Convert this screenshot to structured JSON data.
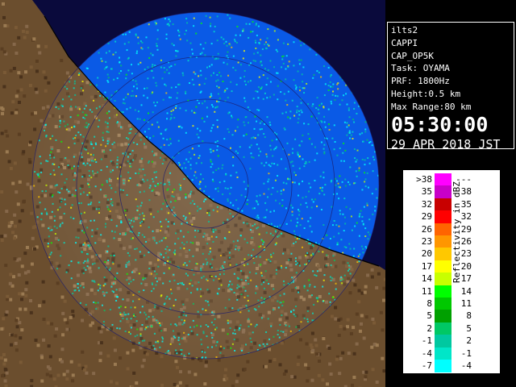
{
  "info": {
    "lines": [
      "ilts2",
      "CAPPI",
      "CAP_OP5K",
      "Task: OYAMA",
      "PRF: 1800Hz",
      "Height:0.5 km",
      "Max Range:80 km"
    ],
    "time": "05:30:00",
    "date": "29 APR 2018 JST"
  },
  "legend": {
    "unit_label": "Reflectivity in dBZ",
    "rows": [
      {
        "lo": ">38",
        "hi": "---",
        "color": "#ff00ff"
      },
      {
        "lo": "35",
        "hi": "38",
        "color": "#c800c8"
      },
      {
        "lo": "32",
        "hi": "35",
        "color": "#c80000"
      },
      {
        "lo": "29",
        "hi": "32",
        "color": "#ff0000"
      },
      {
        "lo": "26",
        "hi": "29",
        "color": "#ff6400"
      },
      {
        "lo": "23",
        "hi": "26",
        "color": "#ff9600"
      },
      {
        "lo": "20",
        "hi": "23",
        "color": "#ffc800"
      },
      {
        "lo": "17",
        "hi": "20",
        "color": "#ffff00"
      },
      {
        "lo": "14",
        "hi": "17",
        "color": "#c8ff00"
      },
      {
        "lo": "11",
        "hi": "14",
        "color": "#00ff00"
      },
      {
        "lo": "8",
        "hi": "11",
        "color": "#00c800"
      },
      {
        "lo": "5",
        "hi": "8",
        "color": "#00a000"
      },
      {
        "lo": "2",
        "hi": "5",
        "color": "#00c864"
      },
      {
        "lo": "-1",
        "hi": "2",
        "color": "#00c8a0"
      },
      {
        "lo": "-4",
        "hi": "-1",
        "color": "#00e6c8"
      },
      {
        "lo": "-7",
        "hi": "-4",
        "color": "#00ffff"
      }
    ]
  },
  "map": {
    "ocean_color": "#0046dc",
    "land_color": "#8c6e4b",
    "coast_color": "#000000",
    "ring_color": "#1e1e6e"
  }
}
